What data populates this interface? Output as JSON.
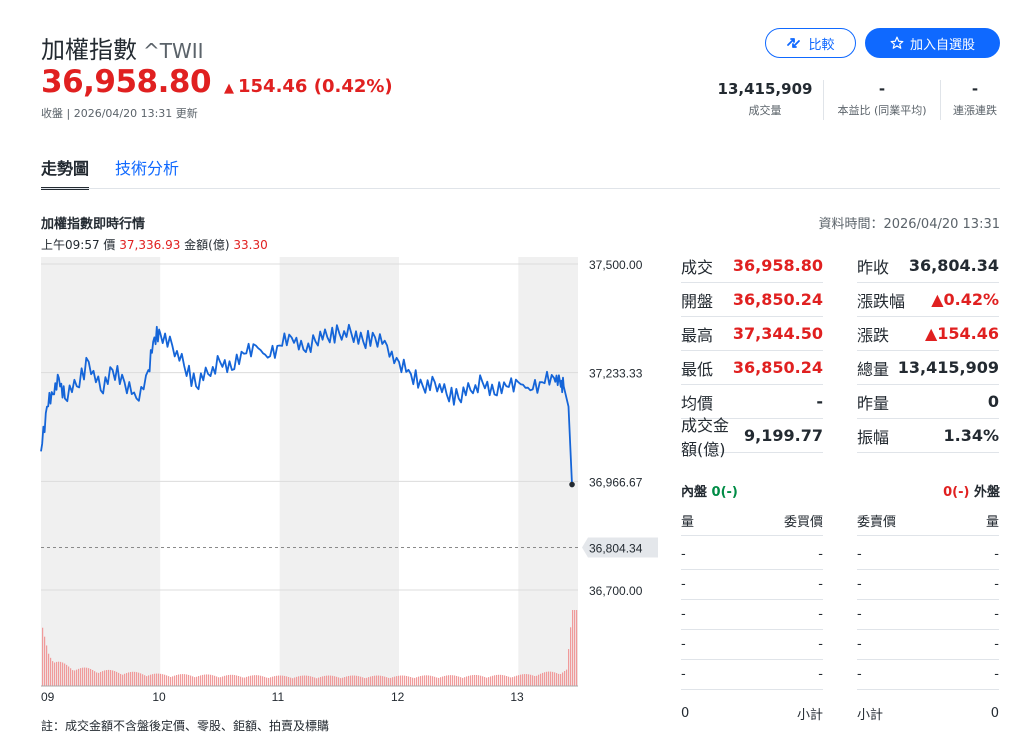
{
  "header": {
    "title": "加權指數",
    "symbol": "^TWII",
    "price": "36,958.80",
    "change": "154.46 (0.42%)",
    "change_arrow": "▲",
    "closing_info": "收盤 | 2026/04/20 13:31 更新",
    "compare_label": "比較",
    "watch_label": "加入自選股"
  },
  "stats": [
    {
      "value": "13,415,909",
      "label": "成交量"
    },
    {
      "value": "-",
      "label": "本益比 (同業平均)"
    },
    {
      "value": "-",
      "label": "連漲連跌"
    }
  ],
  "tabs": [
    {
      "label": "走勢圖",
      "active": true
    },
    {
      "label": "技術分析",
      "active": false
    }
  ],
  "section": {
    "title": "加權指數即時行情",
    "data_time": "資料時間：2026/04/20 13:31",
    "info_time": "上午09:57",
    "info_price_label": "價",
    "info_price": "37,336.93",
    "info_amount_label": "金額(億)",
    "info_amount": "33.30"
  },
  "chart_data": {
    "type": "line",
    "y_ticks": [
      "37,500.00",
      "37,233.33",
      "36,966.67",
      "36,700.00"
    ],
    "x_ticks": [
      "09",
      "10",
      "11",
      "12",
      "13"
    ],
    "prev_close": 36804.34,
    "prev_close_label": "36,804.34",
    "ylim": [
      36700,
      37500
    ],
    "hours": [
      9,
      13.5
    ],
    "line_x": [
      9.0,
      9.05,
      9.1,
      9.15,
      9.2,
      9.3,
      9.4,
      9.5,
      9.6,
      9.7,
      9.8,
      9.9,
      9.95,
      10.0,
      10.1,
      10.2,
      10.3,
      10.4,
      10.5,
      10.6,
      10.7,
      10.8,
      10.9,
      11.0,
      11.1,
      11.2,
      11.3,
      11.4,
      11.5,
      11.6,
      11.7,
      11.8,
      11.9,
      12.0,
      12.1,
      12.2,
      12.3,
      12.4,
      12.5,
      12.6,
      12.7,
      12.8,
      12.9,
      13.0,
      13.1,
      13.2,
      13.3,
      13.35,
      13.38,
      13.42,
      13.45
    ],
    "line_y": [
      37040,
      37150,
      37180,
      37220,
      37170,
      37200,
      37260,
      37190,
      37240,
      37210,
      37170,
      37240,
      37320,
      37330,
      37300,
      37250,
      37200,
      37230,
      37260,
      37240,
      37280,
      37300,
      37270,
      37300,
      37320,
      37290,
      37310,
      37320,
      37330,
      37330,
      37310,
      37320,
      37300,
      37260,
      37230,
      37200,
      37210,
      37180,
      37170,
      37190,
      37210,
      37180,
      37200,
      37210,
      37190,
      37210,
      37220,
      37210,
      37200,
      37150,
      36958.8
    ],
    "volume_profile_x": [
      9.0,
      9.1,
      9.3,
      9.6,
      10.0,
      11.0,
      12.0,
      13.0,
      13.35,
      13.4,
      13.45
    ],
    "volume_profile_y": [
      0.75,
      0.3,
      0.22,
      0.18,
      0.14,
      0.12,
      0.12,
      0.13,
      0.18,
      0.2,
      0.92
    ]
  },
  "quote": {
    "left": [
      {
        "label": "成交",
        "value": "36,958.80",
        "color": "red"
      },
      {
        "label": "開盤",
        "value": "36,850.24",
        "color": "red"
      },
      {
        "label": "最高",
        "value": "37,344.50",
        "color": "red"
      },
      {
        "label": "最低",
        "value": "36,850.24",
        "color": "red"
      },
      {
        "label": "均價",
        "value": "-",
        "color": "dark"
      },
      {
        "label": "成交金額(億)",
        "value": "9,199.77",
        "color": "dark"
      }
    ],
    "right": [
      {
        "label": "昨收",
        "value": "36,804.34",
        "color": "dark"
      },
      {
        "label": "漲跌幅",
        "value": "▲0.42%",
        "color": "red"
      },
      {
        "label": "漲跌",
        "value": "▲154.46",
        "color": "red"
      },
      {
        "label": "總量",
        "value": "13,415,909",
        "color": "dark"
      },
      {
        "label": "昨量",
        "value": "0",
        "color": "dark"
      },
      {
        "label": "振幅",
        "value": "1.34%",
        "color": "dark"
      }
    ]
  },
  "orderbook": {
    "inner_label": "內盤",
    "inner_value": "0(-)",
    "outer_label": "外盤",
    "outer_value": "0(-)",
    "headers": [
      "量",
      "委買價",
      "委賣價",
      "量"
    ],
    "rows": [
      [
        "-",
        "-",
        "-",
        "-"
      ],
      [
        "-",
        "-",
        "-",
        "-"
      ],
      [
        "-",
        "-",
        "-",
        "-"
      ],
      [
        "-",
        "-",
        "-",
        "-"
      ],
      [
        "-",
        "-",
        "-",
        "-"
      ]
    ],
    "buy_total": "0",
    "buy_subtotal_label": "小計",
    "sell_subtotal_label": "小計",
    "sell_total": "0"
  },
  "note": "註：成交金額不含盤後定價、零股、鉅額、拍賣及標購",
  "colors": {
    "red": "#e02020",
    "green": "#008c46",
    "blue": "#0f69ff",
    "line": "#1565d8",
    "dark": "#232a31"
  }
}
